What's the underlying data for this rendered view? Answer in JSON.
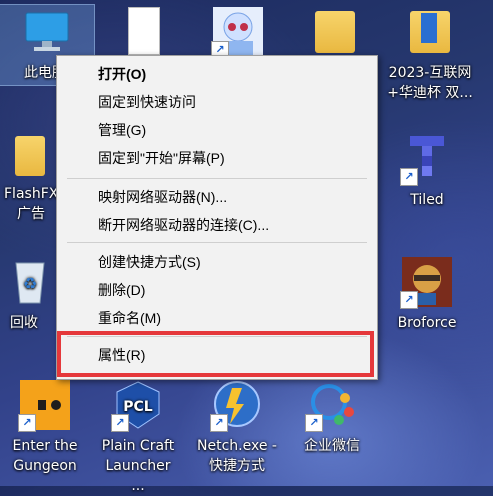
{
  "desktop_icons": [
    {
      "id": "this-pc",
      "label": "此电脑"
    },
    {
      "id": "doc-file",
      "label": ""
    },
    {
      "id": "anime-shortcut",
      "label": ""
    },
    {
      "id": "folder-top",
      "label": ""
    },
    {
      "id": "folder-2023",
      "label": "2023-互联网+华迪杯 双..."
    },
    {
      "id": "flashfxp",
      "label": "FlashFX 广告"
    },
    {
      "id": "tiled",
      "label": "Tiled"
    },
    {
      "id": "recycle-bin",
      "label": "回收"
    },
    {
      "id": "broforce",
      "label": "Broforce"
    },
    {
      "id": "enter-gungeon",
      "label": "Enter the Gungeon"
    },
    {
      "id": "plain-craft",
      "label": "Plain Craft Launcher ..."
    },
    {
      "id": "netch",
      "label": "Netch.exe - 快捷方式"
    },
    {
      "id": "wecom",
      "label": "企业微信"
    }
  ],
  "context_menu": {
    "items": [
      {
        "label": "打开(O)",
        "bold": true
      },
      {
        "label": "固定到快速访问"
      },
      {
        "label": "管理(G)"
      },
      {
        "label": "固定到\"开始\"屏幕(P)"
      },
      {
        "label": "映射网络驱动器(N)..."
      },
      {
        "label": "断开网络驱动器的连接(C)..."
      },
      {
        "label": "创建快捷方式(S)"
      },
      {
        "label": "删除(D)"
      },
      {
        "label": "重命名(M)"
      },
      {
        "label": "属性(R)",
        "highlighted": true
      }
    ]
  },
  "colors": {
    "highlight_box": "#e5383b",
    "menu_bg": "#f2f2f2"
  }
}
